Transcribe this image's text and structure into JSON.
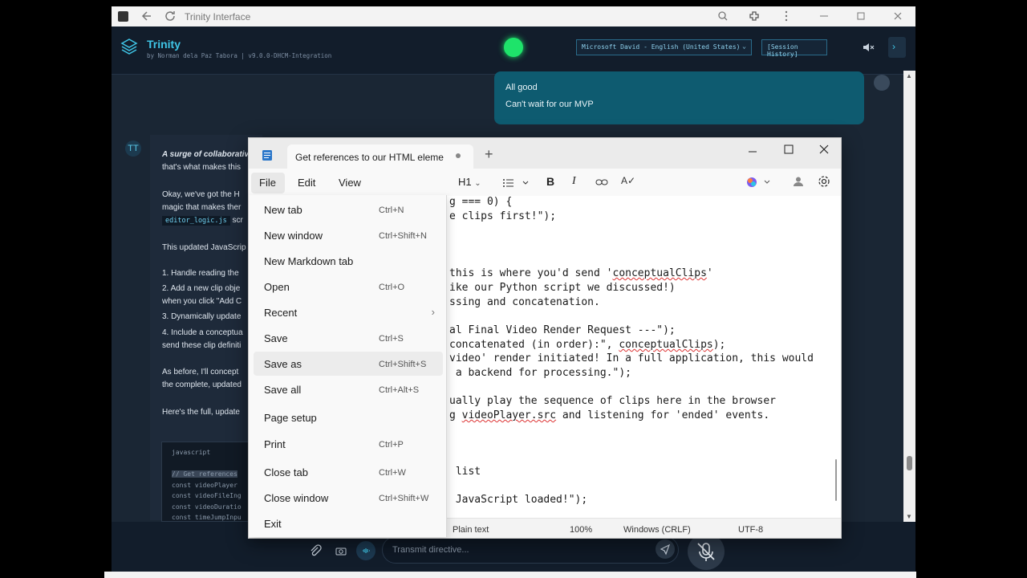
{
  "browser": {
    "title": "Trinity Interface"
  },
  "app": {
    "name": "Trinity",
    "subtitle": "by Norman dela Paz Tabora | v9.0.0-DHCM-Integration",
    "voice_select": "Microsoft David - English (United States)",
    "session_history": "[Session History]",
    "status_color": "#1ee36a",
    "accent": "#3fc5e6"
  },
  "chat": {
    "user_message": [
      "All good",
      "Can't wait for our MVP"
    ],
    "ai_avatar": "TT",
    "ai_lines": [
      "A surge of collaborativ",
      "that's what makes this",
      "Okay, we've got the H",
      "magic that makes ther",
      "scr",
      "This updated JavaScrip",
      "1. Handle reading the",
      "2. Add a new clip obje",
      "when you click \"Add C",
      "3. Dynamically update",
      "4. Include a conceptua",
      "send these clip definiti",
      "As before, I'll concept",
      "the complete, updated",
      "Here's the full, update"
    ],
    "code_chip": "editor_logic.js",
    "code_lang": "javascript",
    "code_lines": [
      "// Get references",
      "const videoPlayer",
      "const videoFileIng",
      "const videoDuratio",
      "const timeJumpInpu"
    ],
    "input_placeholder": "Transmit directive..."
  },
  "notepad": {
    "tab_title": "Get references to our HTML eleme",
    "menus": [
      "File",
      "Edit",
      "View"
    ],
    "heading_select": "H1",
    "code_lines": [
      {
        "text": "g === 0) {"
      },
      {
        "text": "e clips first!\");"
      },
      {
        "text": ""
      },
      {
        "text": ""
      },
      {
        "pre": "this is where you'd send '",
        "squig": "conceptualClips",
        "post": "'"
      },
      {
        "text": "ike our Python script we discussed!)"
      },
      {
        "text": "ssing and concatenation."
      },
      {
        "text": ""
      },
      {
        "text": "al Final Video Render Request ---\");"
      },
      {
        "pre": "concatenated (in order):\", ",
        "squig": "conceptualClips",
        "post": ");"
      },
      {
        "text": "video' render initiated! In a full application, this would"
      },
      {
        "text": " a backend for processing.\");"
      },
      {
        "text": ""
      },
      {
        "text": "ually play the sequence of clips here in the browser"
      },
      {
        "pre": "g ",
        "squig": "videoPlayer.src",
        "post": " and listening for 'ended' events."
      },
      {
        "text": ""
      },
      {
        "text": ""
      },
      {
        "text": " list"
      },
      {
        "text": ""
      },
      {
        "text": " JavaScript loaded!\");"
      }
    ],
    "status": {
      "format": "Plain text",
      "zoom": "100%",
      "line_ending": "Windows (CRLF)",
      "encoding": "UTF-8"
    },
    "file_menu": [
      {
        "label": "New tab",
        "shortcut": "Ctrl+N"
      },
      {
        "label": "New window",
        "shortcut": "Ctrl+Shift+N"
      },
      {
        "label": "New Markdown tab",
        "shortcut": ""
      },
      {
        "label": "Open",
        "shortcut": "Ctrl+O"
      },
      {
        "label": "Recent",
        "shortcut": "",
        "submenu": "›"
      },
      {
        "label": "Save",
        "shortcut": "Ctrl+S"
      },
      {
        "label": "Save as",
        "shortcut": "Ctrl+Shift+S"
      },
      {
        "label": "Save all",
        "shortcut": "Ctrl+Alt+S"
      },
      {
        "label": "Page setup",
        "shortcut": ""
      },
      {
        "label": "Print",
        "shortcut": "Ctrl+P"
      },
      {
        "label": "Close tab",
        "shortcut": "Ctrl+W"
      },
      {
        "label": "Close window",
        "shortcut": "Ctrl+Shift+W"
      },
      {
        "label": "Exit",
        "shortcut": ""
      }
    ]
  }
}
